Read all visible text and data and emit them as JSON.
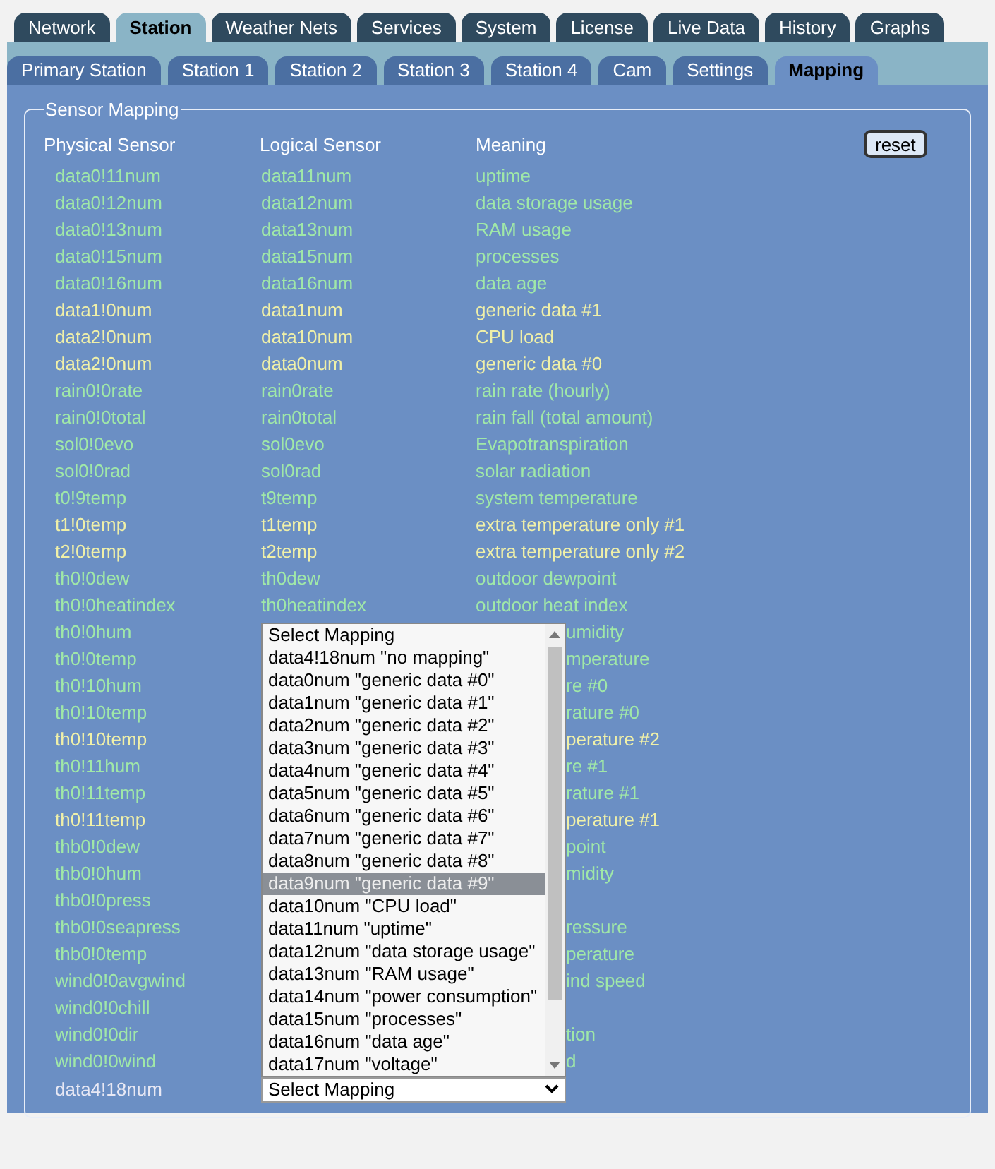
{
  "main_tabs": [
    {
      "label": "Network",
      "selected": false
    },
    {
      "label": "Station",
      "selected": true
    },
    {
      "label": "Weather Nets",
      "selected": false
    },
    {
      "label": "Services",
      "selected": false
    },
    {
      "label": "System",
      "selected": false
    },
    {
      "label": "License",
      "selected": false
    },
    {
      "label": "Live Data",
      "selected": false
    },
    {
      "label": "History",
      "selected": false
    },
    {
      "label": "Graphs",
      "selected": false
    }
  ],
  "sub_tabs": [
    {
      "label": "Primary Station",
      "selected": false
    },
    {
      "label": "Station 1",
      "selected": false
    },
    {
      "label": "Station 2",
      "selected": false
    },
    {
      "label": "Station 3",
      "selected": false
    },
    {
      "label": "Station 4",
      "selected": false
    },
    {
      "label": "Cam",
      "selected": false
    },
    {
      "label": "Settings",
      "selected": false
    },
    {
      "label": "Mapping",
      "selected": true
    }
  ],
  "panel": {
    "legend": "Sensor Mapping",
    "columns": [
      "Physical Sensor",
      "Logical Sensor",
      "Meaning"
    ],
    "reset_button": "reset",
    "rows": [
      {
        "physical": "data0!11num",
        "logical": "data11num",
        "meaning": "uptime",
        "color": "#a0e8a8"
      },
      {
        "physical": "data0!12num",
        "logical": "data12num",
        "meaning": "data storage usage",
        "color": "#a0e8a8"
      },
      {
        "physical": "data0!13num",
        "logical": "data13num",
        "meaning": "RAM usage",
        "color": "#a0e8a8"
      },
      {
        "physical": "data0!15num",
        "logical": "data15num",
        "meaning": "processes",
        "color": "#a0e8a8"
      },
      {
        "physical": "data0!16num",
        "logical": "data16num",
        "meaning": "data age",
        "color": "#a0e8a8"
      },
      {
        "physical": "data1!0num",
        "logical": "data1num",
        "meaning": "generic data #1",
        "color": "#f0f0a8"
      },
      {
        "physical": "data2!0num",
        "logical": "data10num",
        "meaning": "CPU load",
        "color": "#f0f0a8"
      },
      {
        "physical": "data2!0num",
        "logical": "data0num",
        "meaning": "generic data #0",
        "color": "#f0f0a8"
      },
      {
        "physical": "rain0!0rate",
        "logical": "rain0rate",
        "meaning": "rain rate (hourly)",
        "color": "#a0e8a8"
      },
      {
        "physical": "rain0!0total",
        "logical": "rain0total",
        "meaning": "rain fall (total amount)",
        "color": "#a0e8a8"
      },
      {
        "physical": "sol0!0evo",
        "logical": "sol0evo",
        "meaning": "Evapotranspiration",
        "color": "#a0e8a8"
      },
      {
        "physical": "sol0!0rad",
        "logical": "sol0rad",
        "meaning": "solar radiation",
        "color": "#a0e8a8"
      },
      {
        "physical": "t0!9temp",
        "logical": "t9temp",
        "meaning": "system temperature",
        "color": "#a0e8a8"
      },
      {
        "physical": "t1!0temp",
        "logical": "t1temp",
        "meaning": "extra temperature only #1",
        "color": "#f0f0a8"
      },
      {
        "physical": "t2!0temp",
        "logical": "t2temp",
        "meaning": "extra temperature only #2",
        "color": "#f0f0a8"
      },
      {
        "physical": "th0!0dew",
        "logical": "th0dew",
        "meaning": "outdoor dewpoint",
        "color": "#a0e8a8"
      },
      {
        "physical": "th0!0heatindex",
        "logical": "th0heatindex",
        "meaning": "outdoor heat index",
        "color": "#a0e8a8"
      },
      {
        "physical": "th0!0hum",
        "meaning_tail": "umidity",
        "color": "#a0e8a8"
      },
      {
        "physical": "th0!0temp",
        "meaning_tail": "mperature",
        "color": "#a0e8a8"
      },
      {
        "physical": "th0!10hum",
        "meaning_tail": "re #0",
        "color": "#a0e8a8"
      },
      {
        "physical": "th0!10temp",
        "meaning_tail": "rature #0",
        "color": "#a0e8a8"
      },
      {
        "physical": "th0!10temp",
        "meaning_tail": "perature #2",
        "color": "#f0f0a8"
      },
      {
        "physical": "th0!11hum",
        "meaning_tail": "re #1",
        "color": "#a0e8a8"
      },
      {
        "physical": "th0!11temp",
        "meaning_tail": "rature #1",
        "color": "#a0e8a8"
      },
      {
        "physical": "th0!11temp",
        "meaning_tail": "perature #1",
        "color": "#f0f0a8"
      },
      {
        "physical": "thb0!0dew",
        "meaning_tail": "point",
        "color": "#a0e8a8"
      },
      {
        "physical": "thb0!0hum",
        "meaning_tail": "midity",
        "color": "#a0e8a8"
      },
      {
        "physical": "thb0!0press",
        "color": "#a0e8a8"
      },
      {
        "physical": "thb0!0seapress",
        "meaning_tail": "ressure",
        "color": "#a0e8a8"
      },
      {
        "physical": "thb0!0temp",
        "meaning_tail": "perature",
        "color": "#a0e8a8"
      },
      {
        "physical": "wind0!0avgwind",
        "meaning_tail": "ind speed",
        "color": "#a0e8a8"
      },
      {
        "physical": "wind0!0chill",
        "color": "#a0e8a8"
      },
      {
        "physical": "wind0!0dir",
        "meaning_tail": "tion",
        "color": "#a0e8a8"
      },
      {
        "physical": "wind0!0wind",
        "meaning_tail": "d",
        "color": "#a0e8a8"
      }
    ],
    "edit_row": {
      "physical": "data4!18num",
      "color": "#e8e8f4",
      "select": "Select Mapping"
    },
    "dropdown_options": [
      {
        "label": "Select Mapping",
        "selected": false
      },
      {
        "label": "data4!18num \"no mapping\"",
        "selected": false
      },
      {
        "label": "data0num \"generic data #0\"",
        "selected": false
      },
      {
        "label": "data1num \"generic data #1\"",
        "selected": false
      },
      {
        "label": "data2num \"generic data #2\"",
        "selected": false
      },
      {
        "label": "data3num \"generic data #3\"",
        "selected": false
      },
      {
        "label": "data4num \"generic data #4\"",
        "selected": false
      },
      {
        "label": "data5num \"generic data #5\"",
        "selected": false
      },
      {
        "label": "data6num \"generic data #6\"",
        "selected": false
      },
      {
        "label": "data7num \"generic data #7\"",
        "selected": false
      },
      {
        "label": "data8num \"generic data #8\"",
        "selected": false
      },
      {
        "label": "data9num \"generic data #9\"",
        "selected": true
      },
      {
        "label": "data10num \"CPU load\"",
        "selected": false
      },
      {
        "label": "data11num \"uptime\"",
        "selected": false
      },
      {
        "label": "data12num \"data storage usage\"",
        "selected": false
      },
      {
        "label": "data13num \"RAM usage\"",
        "selected": false
      },
      {
        "label": "data14num \"power consumption\"",
        "selected": false
      },
      {
        "label": "data15num \"processes\"",
        "selected": false
      },
      {
        "label": "data16num \"data age\"",
        "selected": false
      },
      {
        "label": "data17num \"voltage\"",
        "selected": false
      }
    ]
  }
}
